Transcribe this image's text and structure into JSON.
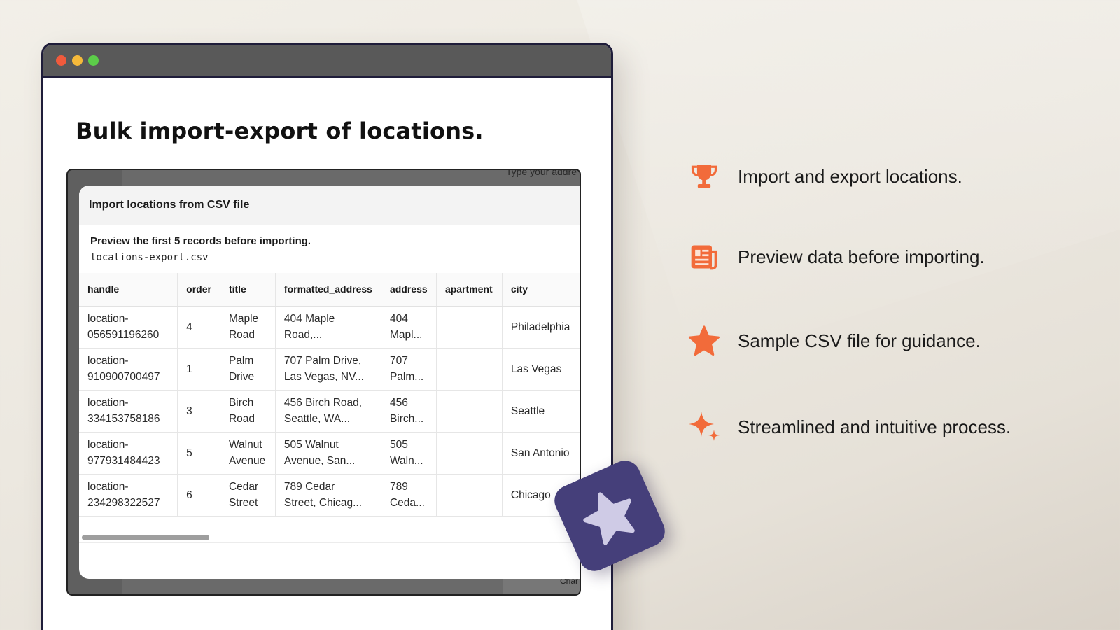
{
  "headline": "Bulk import-export of locations.",
  "app": {
    "background_hint_text": "Type your addre",
    "background_chart_label": "Char",
    "modal": {
      "title": "Import locations from CSV file",
      "description": "Preview the first 5 records before importing.",
      "filename": "locations-export.csv",
      "columns": [
        "handle",
        "order",
        "title",
        "formatted_address",
        "address",
        "apartment",
        "city"
      ],
      "rows": [
        [
          "location-\n056591196260",
          "4",
          "Maple\nRoad",
          "404 Maple\nRoad,...",
          "404\nMapl...",
          "",
          "Philadelphia"
        ],
        [
          "location-\n910900700497",
          "1",
          "Palm\nDrive",
          "707 Palm Drive,\nLas Vegas, NV...",
          "707\nPalm...",
          "",
          "Las Vegas"
        ],
        [
          "location-\n334153758186",
          "3",
          "Birch\nRoad",
          "456 Birch Road,\nSeattle, WA...",
          "456\nBirch...",
          "",
          "Seattle"
        ],
        [
          "location-\n977931484423",
          "5",
          "Walnut\nAvenue",
          "505 Walnut\nAvenue, San...",
          "505\nWaln...",
          "",
          "San Antonio"
        ],
        [
          "location-\n234298322527",
          "6",
          "Cedar\nStreet",
          "789 Cedar\nStreet, Chicag...",
          "789\nCeda...",
          "",
          "Chicago"
        ]
      ]
    }
  },
  "features": [
    {
      "icon": "trophy-icon",
      "label": "Import and export locations."
    },
    {
      "icon": "document-icon",
      "label": "Preview data before importing."
    },
    {
      "icon": "star-icon",
      "label": "Sample CSV file for guidance."
    },
    {
      "icon": "sparkle-icon",
      "label": "Streamlined and intuitive process."
    }
  ],
  "colors": {
    "accent": "#f26b3a",
    "badge": "#453f7a",
    "window_border": "#1f1d3a",
    "titlebar": "#595959"
  }
}
